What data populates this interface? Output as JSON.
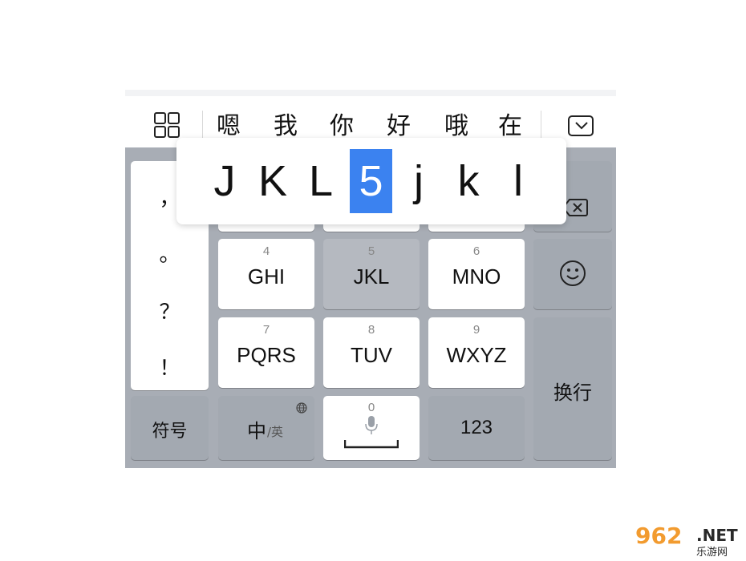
{
  "candidates": [
    "嗯",
    "我",
    "你",
    "好",
    "哦",
    "在"
  ],
  "popup": {
    "chars": [
      "J",
      "K",
      "L",
      "5",
      "j",
      "k",
      "l"
    ],
    "selected": "5"
  },
  "left_column": {
    "items": [
      "，",
      "。",
      "？",
      "！"
    ]
  },
  "keys": {
    "row1": [
      {
        "num": "4",
        "label": "GHI"
      },
      {
        "num": "5",
        "label": "JKL"
      },
      {
        "num": "6",
        "label": "MNO"
      }
    ],
    "row2": [
      {
        "num": "7",
        "label": "PQRS"
      },
      {
        "num": "8",
        "label": "TUV"
      },
      {
        "num": "9",
        "label": "WXYZ"
      }
    ],
    "bottom": {
      "symbol": "符号",
      "lang_main": "中",
      "lang_sub": "/英",
      "space_num": "0",
      "numbers": "123"
    },
    "enter": "换行"
  },
  "icons": {
    "menu": "grid-icon",
    "collapse": "keyboard-collapse-icon",
    "backspace": "backspace-icon",
    "emoji": "emoji-icon",
    "mic": "microphone-icon",
    "globe": "globe-icon"
  },
  "colors": {
    "accent": "#3b82f0",
    "keyboard_bg": "#a8adb5",
    "key_white": "#ffffff"
  },
  "watermark": {
    "main": "962",
    "net": ".NET",
    "sub": "乐游网"
  }
}
